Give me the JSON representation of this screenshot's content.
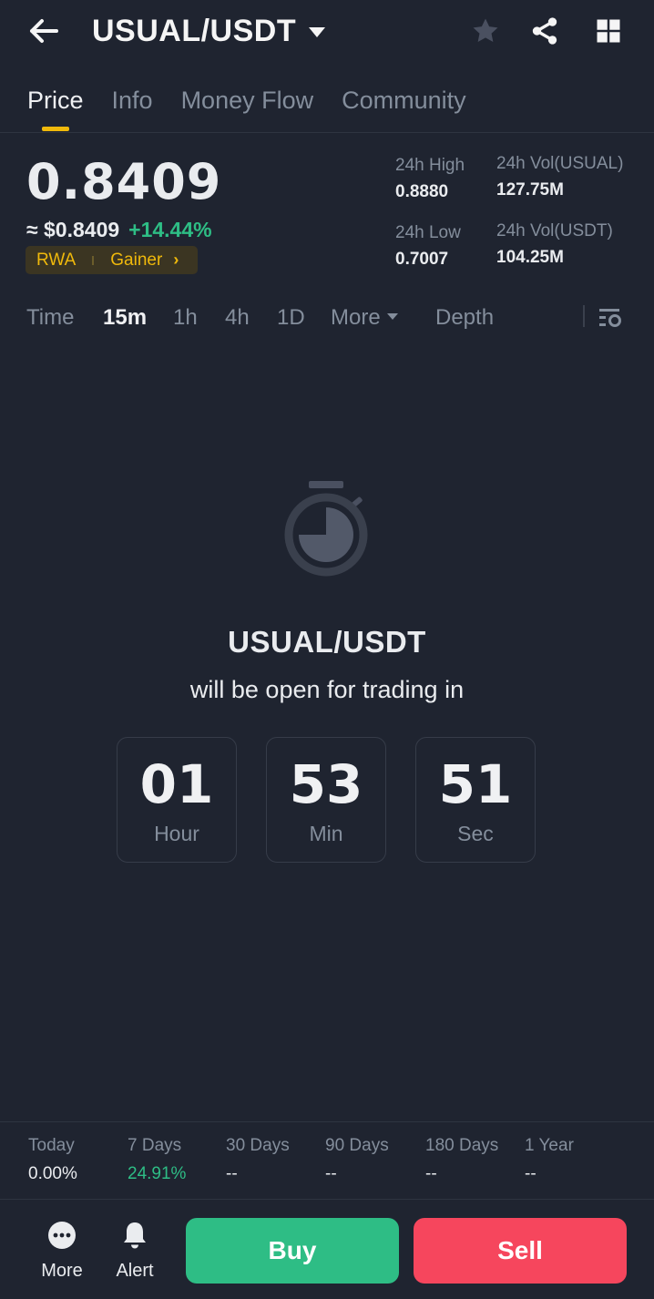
{
  "header": {
    "pair": "USUAL/USDT"
  },
  "tabs": [
    {
      "label": "Price",
      "active": true
    },
    {
      "label": "Info",
      "active": false
    },
    {
      "label": "Money Flow",
      "active": false
    },
    {
      "label": "Community",
      "active": false
    }
  ],
  "ticker": {
    "last_price": "0.8409",
    "fiat_price": "≈ $0.8409",
    "change_pct": "+14.44%",
    "tags": [
      "RWA",
      "Gainer"
    ],
    "high_24h_label": "24h High",
    "high_24h": "0.8880",
    "low_24h_label": "24h Low",
    "low_24h": "0.7007",
    "vol_base_label": "24h Vol(USUAL)",
    "vol_base": "127.75M",
    "vol_quote_label": "24h Vol(USDT)",
    "vol_quote": "104.25M"
  },
  "intervals": {
    "time": "Time",
    "m15": "15m",
    "h1": "1h",
    "h4": "4h",
    "d1": "1D",
    "more": "More",
    "depth": "Depth"
  },
  "countdown": {
    "pair": "USUAL/USDT",
    "message": "will be open for trading in",
    "hours": "01",
    "hours_label": "Hour",
    "minutes": "53",
    "minutes_label": "Min",
    "seconds": "51",
    "seconds_label": "Sec"
  },
  "performance": [
    {
      "label": "Today",
      "value": "0.00%"
    },
    {
      "label": "7 Days",
      "value": "24.91%"
    },
    {
      "label": "30 Days",
      "value": "--"
    },
    {
      "label": "90 Days",
      "value": "--"
    },
    {
      "label": "180 Days",
      "value": "--"
    },
    {
      "label": "1 Year",
      "value": "--"
    }
  ],
  "bottom_bar": {
    "more": "More",
    "alert": "Alert",
    "buy": "Buy",
    "sell": "Sell"
  },
  "colors": {
    "background": "#1f2430",
    "accent": "#f0b90b",
    "up": "#2ebd85",
    "down": "#f6465d"
  }
}
